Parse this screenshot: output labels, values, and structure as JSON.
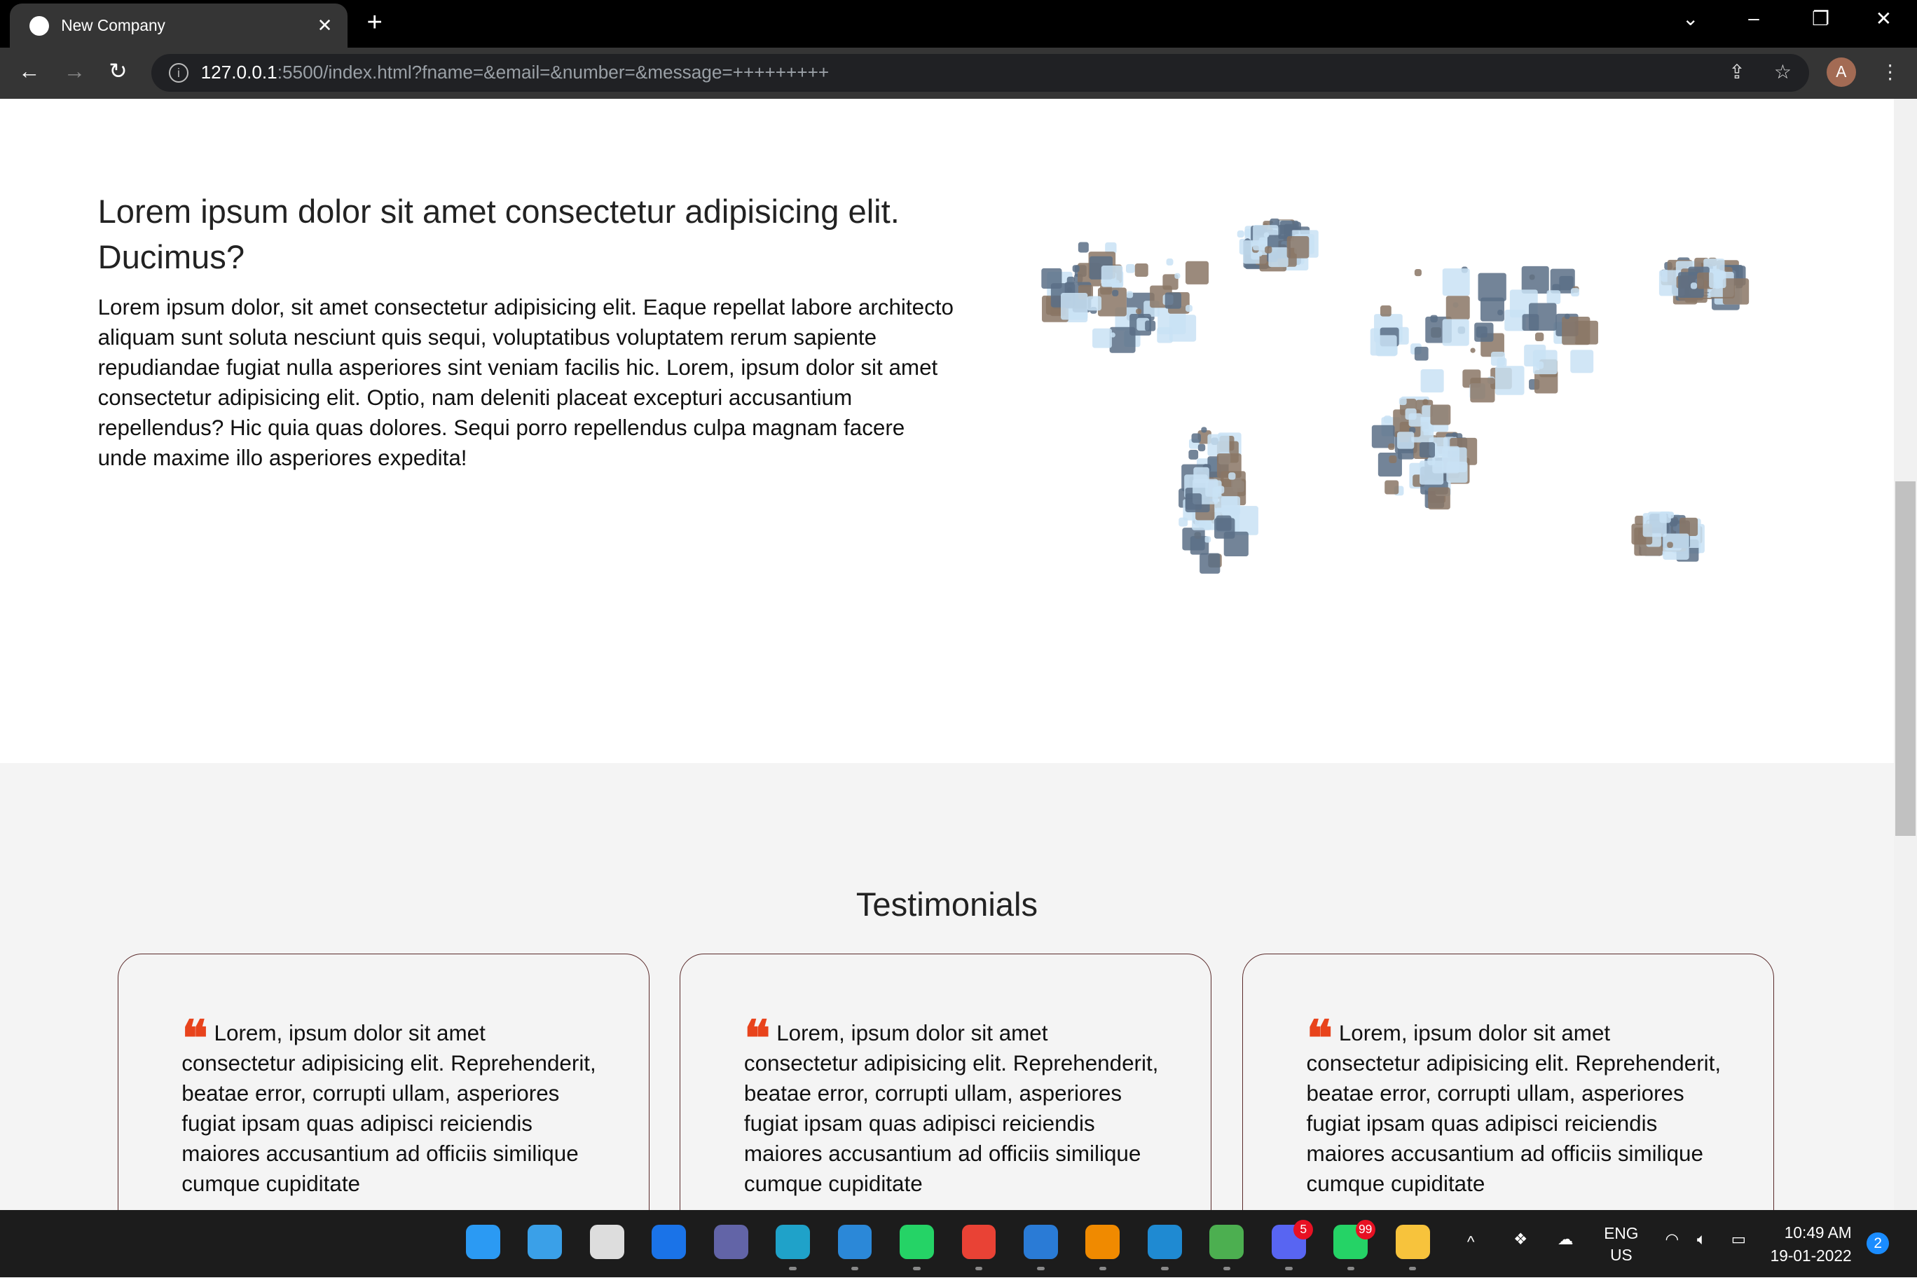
{
  "browser": {
    "tab_title": "New Company",
    "url_host": "127.0.0.1",
    "url_rest": ":5500/index.html?fname=&email=&number=&message=+++++++++",
    "avatar_letter": "A"
  },
  "about": {
    "heading": "Lorem ipsum dolor sit amet consectetur adipisicing elit. Ducimus?",
    "body": "Lorem ipsum dolor, sit amet consectetur adipisicing elit. Eaque repellat labore architecto aliquam sunt soluta nesciunt quis sequi, voluptatibus voluptatem rerum sapiente repudiandae fugiat nulla asperiores sint veniam facilis hic. Lorem, ipsum dolor sit amet consectetur adipisicing elit. Optio, nam deleniti placeat excepturi accusantium repellendus? Hic quia quas dolores. Sequi porro repellendus culpa magnam facere unde maxime illo asperiores expedita!"
  },
  "testimonials": {
    "title": "Testimonials",
    "cards": [
      {
        "text": "Lorem, ipsum dolor sit amet consectetur adipisicing elit. Reprehenderit, beatae error, corrupti ullam, asperiores fugiat ipsam quas adipisci reiciendis maiores accusantium ad officiis similique cumque cupiditate"
      },
      {
        "text": "Lorem, ipsum dolor sit amet consectetur adipisicing elit. Reprehenderit, beatae error, corrupti ullam, asperiores fugiat ipsam quas adipisci reiciendis maiores accusantium ad officiis similique cumque cupiditate"
      },
      {
        "text": "Lorem, ipsum dolor sit amet consectetur adipisicing elit. Reprehenderit, beatae error, corrupti ullam, asperiores fugiat ipsam quas adipisci reiciendis maiores accusantium ad officiis similique cumque cupiditate"
      }
    ]
  },
  "taskbar": {
    "apps": [
      {
        "name": "start",
        "color": "#2b9af3"
      },
      {
        "name": "search",
        "color": "#3aa0e8"
      },
      {
        "name": "task-view",
        "color": "#ddd"
      },
      {
        "name": "widgets",
        "color": "#1a73e8"
      },
      {
        "name": "teams-chat",
        "color": "#6264a7"
      },
      {
        "name": "edge",
        "color": "#1fa2c9"
      },
      {
        "name": "mail",
        "color": "#2b88d8"
      },
      {
        "name": "whatsapp",
        "color": "#25d366"
      },
      {
        "name": "chrome",
        "color": "#e94235"
      },
      {
        "name": "photos",
        "color": "#2a7bd6"
      },
      {
        "name": "vlc",
        "color": "#f08a00"
      },
      {
        "name": "vscode",
        "color": "#1f8ad2"
      },
      {
        "name": "chrome-profile",
        "color": "#4caf50"
      },
      {
        "name": "discord",
        "color": "#5865f2"
      },
      {
        "name": "whatsapp-2",
        "color": "#25d366"
      },
      {
        "name": "file-explorer",
        "color": "#f7c33c"
      }
    ],
    "discord_badge": "5",
    "whatsapp_badge": "99",
    "lang": "ENG",
    "region": "US",
    "time": "10:49 AM",
    "date": "19-01-2022",
    "notifications": "2"
  }
}
